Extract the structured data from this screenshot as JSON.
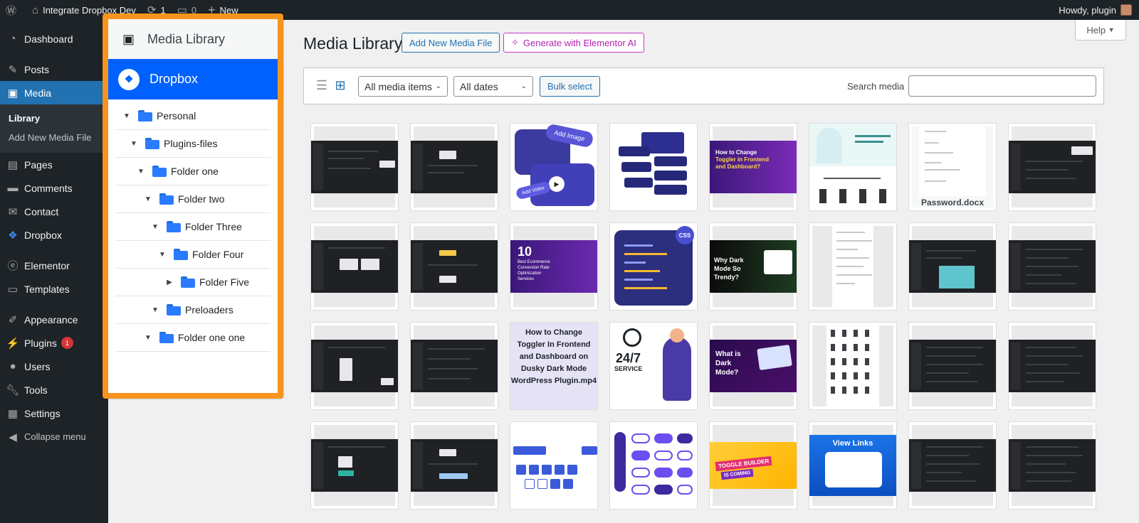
{
  "adminbar": {
    "site_name": "Integrate Dropbox Dev",
    "updates_count": "1",
    "comments_count": "0",
    "new_label": "New",
    "howdy": "Howdy, plugin"
  },
  "sidebar": {
    "items": [
      {
        "label": "Dashboard",
        "icon": "dashboard-icon"
      },
      {
        "label": "Posts",
        "icon": "pin-icon"
      },
      {
        "label": "Media",
        "icon": "media-icon"
      },
      {
        "label": "Pages",
        "icon": "page-icon"
      },
      {
        "label": "Comments",
        "icon": "comment-icon"
      },
      {
        "label": "Contact",
        "icon": "mail-icon"
      },
      {
        "label": "Dropbox",
        "icon": "dropbox-icon"
      },
      {
        "label": "Elementor",
        "icon": "elementor-icon"
      },
      {
        "label": "Templates",
        "icon": "folder-icon"
      },
      {
        "label": "Appearance",
        "icon": "brush-icon"
      },
      {
        "label": "Plugins",
        "icon": "plugin-icon"
      },
      {
        "label": "Users",
        "icon": "user-icon"
      },
      {
        "label": "Tools",
        "icon": "wrench-icon"
      },
      {
        "label": "Settings",
        "icon": "settings-icon"
      },
      {
        "label": "Collapse menu",
        "icon": "collapse-icon"
      }
    ],
    "media_submenu": [
      "Library",
      "Add New Media File"
    ],
    "plugins_badge": "1"
  },
  "folder_panel": {
    "media_library": "Media Library",
    "dropbox": "Dropbox",
    "tree": [
      {
        "label": "Personal",
        "expanded": true
      },
      {
        "label": "Plugins-files",
        "expanded": true
      },
      {
        "label": "Folder one",
        "expanded": true
      },
      {
        "label": "Folder two",
        "expanded": true
      },
      {
        "label": "Folder Three",
        "expanded": true
      },
      {
        "label": "Folder Four",
        "expanded": true
      },
      {
        "label": "Folder Five",
        "expanded": false
      },
      {
        "label": "Preloaders",
        "expanded": true
      },
      {
        "label": "Folder one one",
        "expanded": true
      }
    ]
  },
  "main": {
    "title": "Media Library",
    "add_new": "Add New Media File",
    "generate_ai": "Generate with Elementor AI",
    "help": "Help",
    "filter_type": "All media items",
    "filter_date": "All dates",
    "bulk_select": "Bulk select",
    "search_label": "Search media",
    "search_value": ""
  },
  "thumbs": {
    "password_doc": "Password.docx",
    "toggler_title_a": "How to Change",
    "toggler_title_b": "Toggler in Frontend",
    "toggler_title_c": "and Dashboard?",
    "ecom_num": "10",
    "ecom_text": "Best Ecommerce Conversion Rate Optimization Services",
    "why_dark": "Why Dark Mode So Trendy?",
    "toggler_mp4": "How to Change Toggler In Frontend and Dashboard on Dusky Dark Mode WordPress Plugin.mp4",
    "service_big": "24/7",
    "service_sub": "SERVICE",
    "what_dark": "What is Dark Mode?",
    "view_links": "View Links",
    "toggle_builder": "TOGGLE BUILDER",
    "is_coming": "IS COMING",
    "add_image": "Add Image",
    "add_video": "Add Video",
    "css": "CSS"
  }
}
